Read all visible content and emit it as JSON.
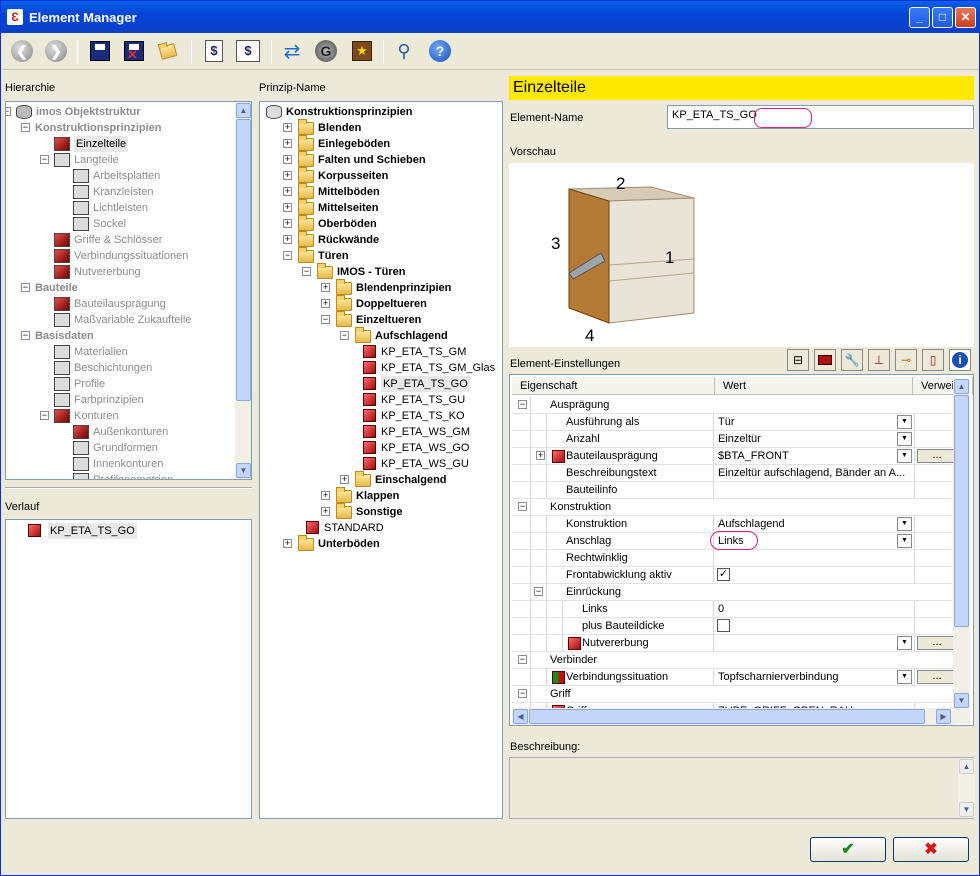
{
  "window": {
    "title": "Element Manager",
    "app_icon": "Ɛ"
  },
  "toolbar": {
    "icons": [
      "back-icon",
      "forward-icon",
      "save-icon",
      "save-close-icon",
      "folder-export-icon",
      "dollar-doc-icon",
      "dollar-window-icon",
      "swap-arrows-icon",
      "globe-icon",
      "book-star-icon",
      "search-icon",
      "help-icon"
    ]
  },
  "hierarchy": {
    "label": "Hierarchie",
    "items": [
      {
        "label": "imos Objektstruktur",
        "style": "bold dim"
      },
      {
        "label": "Konstruktionsprinzipien",
        "style": "bold dim"
      },
      {
        "label": "Einzelteile",
        "style": "sel"
      },
      {
        "label": "Langteile",
        "style": "dim"
      },
      {
        "label": "Arbeitsplatten",
        "style": "dim"
      },
      {
        "label": "Kranzleisten",
        "style": "dim"
      },
      {
        "label": "Lichtleisten",
        "style": "dim"
      },
      {
        "label": "Sockel",
        "style": "dim"
      },
      {
        "label": "Griffe & Schlösser",
        "style": "dim"
      },
      {
        "label": "Verbindungssituationen",
        "style": "dim"
      },
      {
        "label": "Nutvererbung",
        "style": "dim"
      },
      {
        "label": "Bauteile",
        "style": "bold dim"
      },
      {
        "label": "Bauteilausprägung",
        "style": "dim"
      },
      {
        "label": "Maßvariable Zukaufteile",
        "style": "dim"
      },
      {
        "label": "Basisdaten",
        "style": "bold dim"
      },
      {
        "label": "Materialien",
        "style": "dim"
      },
      {
        "label": "Beschichtungen",
        "style": "dim"
      },
      {
        "label": "Profile",
        "style": "dim"
      },
      {
        "label": "Farbprinzipien",
        "style": "dim"
      },
      {
        "label": "Konturen",
        "style": "dim"
      },
      {
        "label": "Außenkonturen",
        "style": "dim"
      },
      {
        "label": "Grundformen",
        "style": "dim"
      },
      {
        "label": "Innenkonturen",
        "style": "dim"
      },
      {
        "label": "Profilgeometrien",
        "style": "dim"
      }
    ]
  },
  "history": {
    "label": "Verlauf",
    "items": [
      "KP_ETA_TS_GO"
    ]
  },
  "principle": {
    "label": "Prinzip-Name",
    "items": [
      "Konstruktionsprinzipien",
      "Blenden",
      "Einlegeböden",
      "Falten und Schieben",
      "Korpusseiten",
      "Mittelböden",
      "Mittelseiten",
      "Oberböden",
      "Rückwände",
      "Türen",
      "IMOS - Türen",
      "Blendenprinzipien",
      "Doppeltueren",
      "Einzeltueren",
      "Aufschlagend",
      "KP_ETA_TS_GM",
      "KP_ETA_TS_GM_Glas",
      "KP_ETA_TS_GO",
      "KP_ETA_TS_GU",
      "KP_ETA_TS_KO",
      "KP_ETA_WS_GM",
      "KP_ETA_WS_GO",
      "KP_ETA_WS_GU",
      "Einschalgend",
      "Klappen",
      "Sonstige",
      "STANDARD",
      "Unterböden"
    ]
  },
  "detail": {
    "header": "Einzelteile",
    "name_label": "Element-Name",
    "name_value": "KP_ETA_TS_GO",
    "preview_label": "Vorschau",
    "preview_numbers": [
      "1",
      "2",
      "3",
      "4"
    ],
    "settings_label": "Element-Einstellungen",
    "columns": [
      "Eigenschaft",
      "Wert",
      "Verweis"
    ],
    "rows": [
      {
        "prop": "Ausprägung",
        "value": ""
      },
      {
        "prop": "Ausführung als",
        "value": "Tür"
      },
      {
        "prop": "Anzahl",
        "value": "Einzeltür"
      },
      {
        "prop": "Bauteilausprägung",
        "value": "$BTA_FRONT"
      },
      {
        "prop": "Beschreibungstext",
        "value": "Einzeltür aufschlagend, Bänder an A..."
      },
      {
        "prop": "Bauteilinfo",
        "value": ""
      },
      {
        "prop": "Konstruktion",
        "value": ""
      },
      {
        "prop": "Konstruktion",
        "value": "Aufschlagend"
      },
      {
        "prop": "Anschlag",
        "value": "Links"
      },
      {
        "prop": "Rechtwinklig",
        "value": ""
      },
      {
        "prop": "Frontabwicklung aktiv",
        "value": "✓"
      },
      {
        "prop": "Einrückung",
        "value": ""
      },
      {
        "prop": "Links",
        "value": "0"
      },
      {
        "prop": "plus Bauteildicke",
        "value": ""
      },
      {
        "prop": "Nutvererbung",
        "value": ""
      },
      {
        "prop": "Verbinder",
        "value": ""
      },
      {
        "prop": "Verbindungssituation",
        "value": "Topfscharnierverbindung"
      },
      {
        "prop": "Griff",
        "value": ""
      },
      {
        "prop": "Griff",
        "value": "ZUBE_GRIFF_OBEN_RAU"
      }
    ],
    "desc_label": "Beschreibung:"
  },
  "buttons": {
    "ok": "✔",
    "cancel": "✖"
  },
  "colors": {
    "accent": "#ffe900",
    "titlebar": "#0546d6",
    "ok": "#1a8a1a",
    "cancel": "#d41818"
  }
}
